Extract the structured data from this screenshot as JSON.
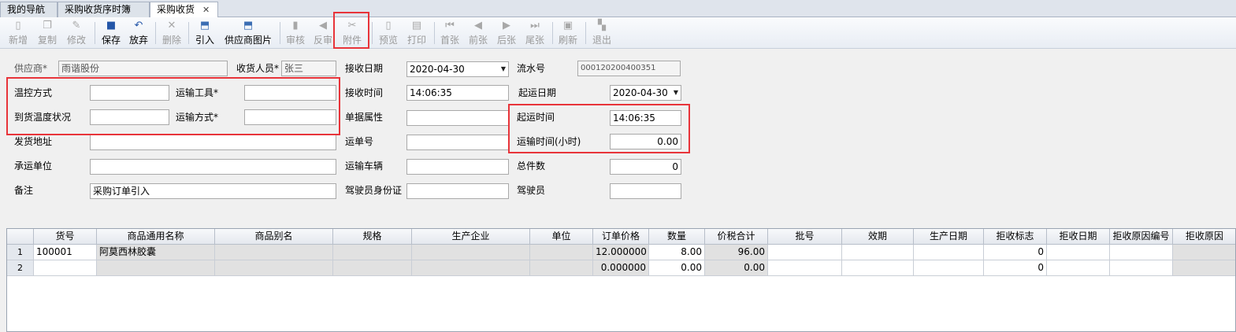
{
  "tabs": [
    {
      "label": "我的导航"
    },
    {
      "label": "采购收货序时簿"
    },
    {
      "label": "采购收货",
      "close": "✕"
    }
  ],
  "toolbar": {
    "new": "新增",
    "copy": "复制",
    "edit": "修改",
    "save": "保存",
    "discard": "放弃",
    "delete": "删除",
    "import": "引入",
    "supplier_image": "供应商图片",
    "audit": "审核",
    "unaudit": "反审",
    "attachment": "附件",
    "preview": "预览",
    "print": "打印",
    "first": "首张",
    "prev": "前张",
    "next": "后张",
    "last": "尾张",
    "refresh": "刷新",
    "exit": "退出"
  },
  "form": {
    "supplier_label": "供应商*",
    "supplier_value": "雨谐股份",
    "receiver_label": "收货人员*",
    "receiver_value": "张三",
    "receive_date_label": "接收日期",
    "receive_date_value": "2020-04-30",
    "serial_label": "流水号",
    "serial_value": "000120200400351",
    "temp_control_label": "温控方式",
    "temp_control_value": "",
    "transport_tool_label": "运输工具*",
    "transport_tool_value": "",
    "receive_time_label": "接收时间",
    "receive_time_value": "14:06:35",
    "ship_date_label": "起运日期",
    "ship_date_value": "2020-04-30",
    "arrival_temp_label": "到货温度状况",
    "arrival_temp_value": "",
    "transport_mode_label": "运输方式*",
    "transport_mode_value": "",
    "doc_attr_label": "单据属性",
    "doc_attr_value": "",
    "ship_time_label": "起运时间",
    "ship_time_value": "14:06:35",
    "ship_address_label": "发货地址",
    "ship_address_value": "",
    "waybill_label": "运单号",
    "waybill_value": "",
    "transit_hours_label": "运输时间(小时)",
    "transit_hours_value": "0.00",
    "carrier_label": "承运单位",
    "carrier_value": "",
    "vehicle_label": "运输车辆",
    "vehicle_value": "",
    "total_pieces_label": "总件数",
    "total_pieces_value": "0",
    "remark_label": "备注",
    "remark_value": "采购订单引入",
    "driver_id_label": "驾驶员身份证",
    "driver_id_value": "",
    "driver_label": "驾驶员",
    "driver_value": ""
  },
  "grid": {
    "headers": [
      "货号",
      "商品通用名称",
      "商品别名",
      "规格",
      "生产企业",
      "单位",
      "订单价格",
      "数量",
      "价税合计",
      "批号",
      "效期",
      "生产日期",
      "拒收标志",
      "拒收日期",
      "拒收原因编号",
      "拒收原因"
    ],
    "rows": [
      {
        "row_no": "1",
        "cells": [
          "100001",
          "阿莫西林胶囊",
          "",
          "",
          "",
          "",
          "12.000000",
          "8.00",
          "96.00",
          "",
          "",
          "",
          "0",
          "",
          "",
          ""
        ]
      },
      {
        "row_no": "2",
        "cells": [
          "",
          "",
          "",
          "",
          "",
          "",
          "0.000000",
          "0.00",
          "0.00",
          "",
          "",
          "",
          "0",
          "",
          "",
          ""
        ]
      }
    ]
  },
  "colors": {
    "highlight": "#e8343a",
    "grid_header": "#e4e8ee",
    "readonly_cell": "#e1e1e1"
  }
}
